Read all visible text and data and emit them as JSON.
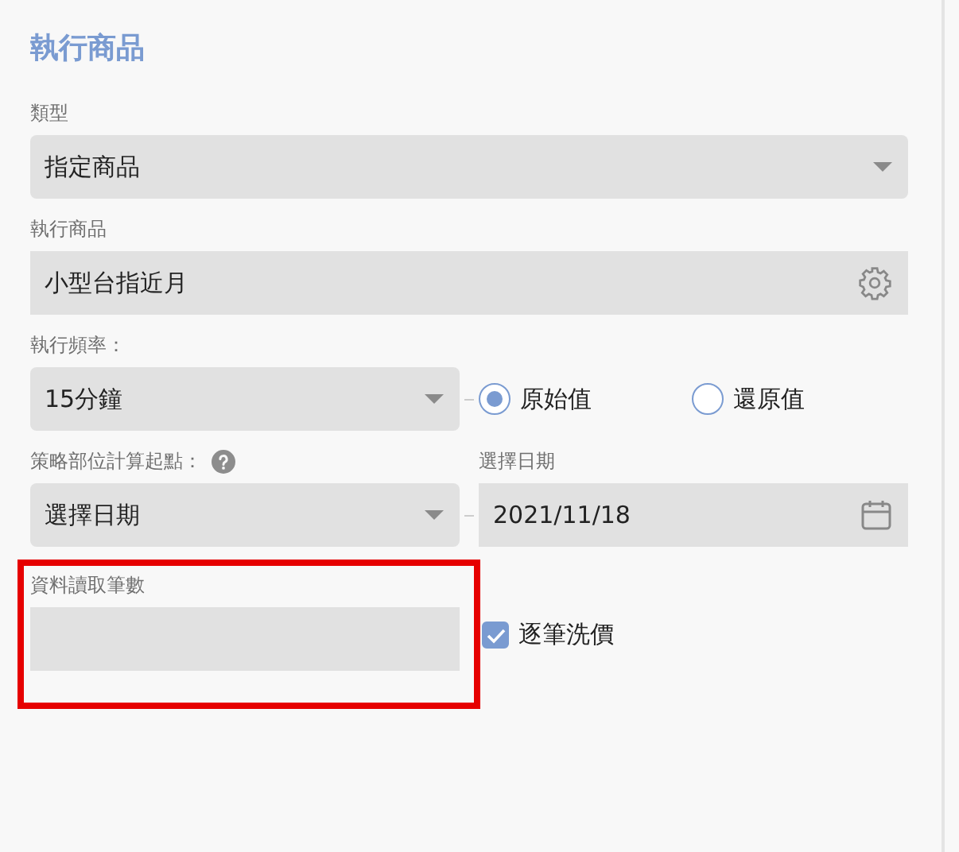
{
  "title": "執行商品",
  "type_field": {
    "label": "類型",
    "value": "指定商品"
  },
  "product_field": {
    "label": "執行商品",
    "value": "小型台指近月"
  },
  "frequency": {
    "label": "執行頻率：",
    "value": "15分鐘",
    "options": [
      {
        "label": "原始值",
        "selected": true
      },
      {
        "label": "還原值",
        "selected": false
      }
    ]
  },
  "start_point": {
    "label": "策略部位計算起點：",
    "value": "選擇日期"
  },
  "date_field": {
    "label": "選擇日期",
    "value": "2021/11/18"
  },
  "record_count": {
    "label": "資料讀取筆數",
    "highlighted": true
  },
  "tick_cleaning": {
    "label": "逐筆洗價",
    "checked": true
  }
}
